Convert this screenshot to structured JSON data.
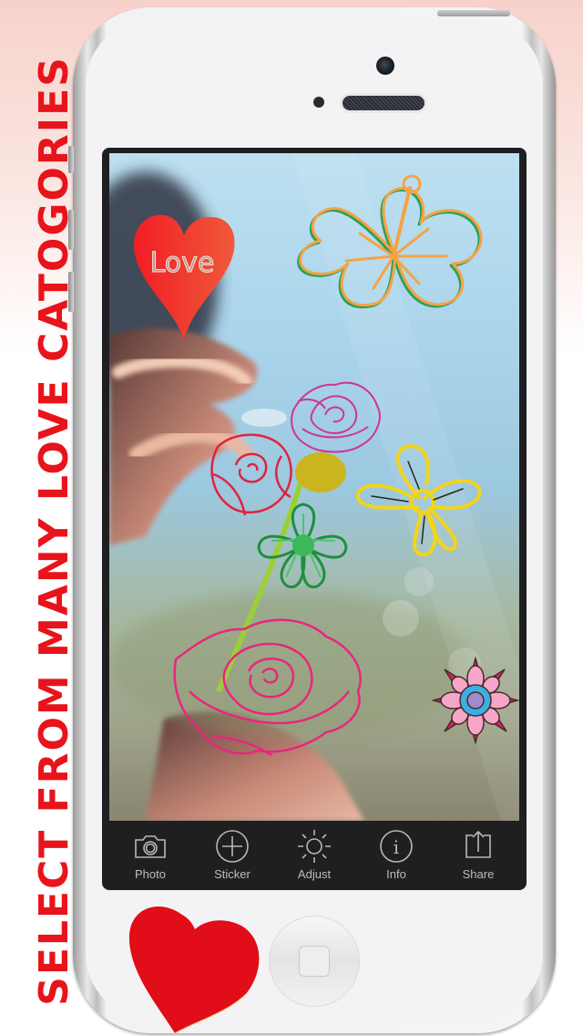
{
  "promo": {
    "headline": "Select from many love catogories",
    "color": "#e8141b"
  },
  "device": {
    "model": "white smartphone",
    "home_button_icon": "home-square-icon"
  },
  "editor": {
    "photo_description": "Hand holding a yellow chamomile flower against a blurred blue sky",
    "stickers": [
      {
        "name": "love-heart-sticker",
        "text": "Love",
        "color": "#e82a2a"
      },
      {
        "name": "hibiscus-sticker",
        "colors": [
          "#f5a343",
          "#2aa05a"
        ]
      },
      {
        "name": "pink-rose-sticker",
        "color": "#d0339a"
      },
      {
        "name": "red-rose-sticker",
        "color": "#e0223f"
      },
      {
        "name": "yellow-flower-sticker",
        "color": "#f2d419"
      },
      {
        "name": "green-flower-sticker",
        "color": "#2aa84a"
      },
      {
        "name": "large-pink-rose-sticker",
        "color": "#e8267e"
      },
      {
        "name": "mandala-flower-sticker",
        "colors": [
          "#d3245a",
          "#f6a6c8",
          "#3ab0e2",
          "#a08ad0"
        ]
      }
    ]
  },
  "toolbar": {
    "items": [
      {
        "label": "Photo",
        "icon": "camera-icon"
      },
      {
        "label": "Sticker",
        "icon": "plus-circle-icon"
      },
      {
        "label": "Adjust",
        "icon": "sun-icon"
      },
      {
        "label": "Info",
        "icon": "info-circle-icon"
      },
      {
        "label": "Share",
        "icon": "share-icon"
      }
    ]
  },
  "decoration": {
    "heart_color": "#e10d18"
  }
}
